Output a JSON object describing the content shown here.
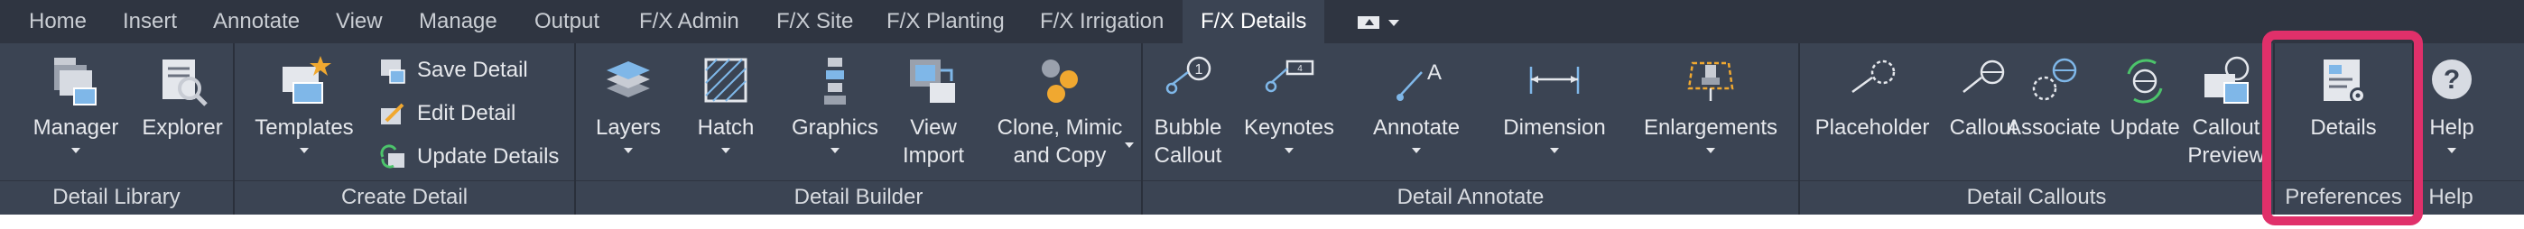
{
  "tabs": [
    {
      "label": "Home"
    },
    {
      "label": "Insert"
    },
    {
      "label": "Annotate"
    },
    {
      "label": "View"
    },
    {
      "label": "Manage"
    },
    {
      "label": "Output"
    },
    {
      "label": "F/X Admin"
    },
    {
      "label": "F/X Site"
    },
    {
      "label": "F/X Planting"
    },
    {
      "label": "F/X Irrigation"
    },
    {
      "label": "F/X Details",
      "active": true
    }
  ],
  "panels": {
    "detail_library": {
      "title": "Detail Library",
      "tools": [
        {
          "label": "Manager"
        },
        {
          "label": "Explorer"
        }
      ]
    },
    "create_detail": {
      "title": "Create Detail",
      "tools": [
        {
          "label": "Templates"
        }
      ],
      "small_tools": [
        {
          "label": "Save Detail"
        },
        {
          "label": "Edit Detail"
        },
        {
          "label": "Update Details"
        }
      ]
    },
    "detail_builder": {
      "title": "Detail Builder",
      "tools": [
        {
          "label": "Layers"
        },
        {
          "label": "Hatch"
        },
        {
          "label": "Graphics"
        },
        {
          "label_line1": "View",
          "label_line2": "Import"
        },
        {
          "label_line1": "Clone, Mimic",
          "label_line2": "and Copy"
        }
      ]
    },
    "detail_annotate": {
      "title": "Detail Annotate",
      "tools": [
        {
          "label_line1": "Bubble",
          "label_line2": "Callout"
        },
        {
          "label": "Keynotes"
        },
        {
          "label": "Annotate"
        },
        {
          "label": "Dimension"
        },
        {
          "label": "Enlargements"
        }
      ]
    },
    "detail_callouts": {
      "title": "Detail Callouts",
      "tools": [
        {
          "label": "Placeholder"
        },
        {
          "label": "Callout"
        },
        {
          "label": "Associate"
        },
        {
          "label": "Update"
        },
        {
          "label_line1": "Callout",
          "label_line2": "Preview"
        }
      ]
    },
    "preferences": {
      "title": "Preferences",
      "tools": [
        {
          "label": "Details"
        }
      ]
    },
    "help": {
      "title": "Help",
      "tools": [
        {
          "label": "Help"
        }
      ]
    }
  },
  "colors": {
    "tabbar_bg": "#2f3541",
    "ribbon_bg": "#3b4453",
    "highlight": "#e0306a",
    "icon_blue": "#7fb7e8",
    "icon_orange": "#f0a830"
  }
}
